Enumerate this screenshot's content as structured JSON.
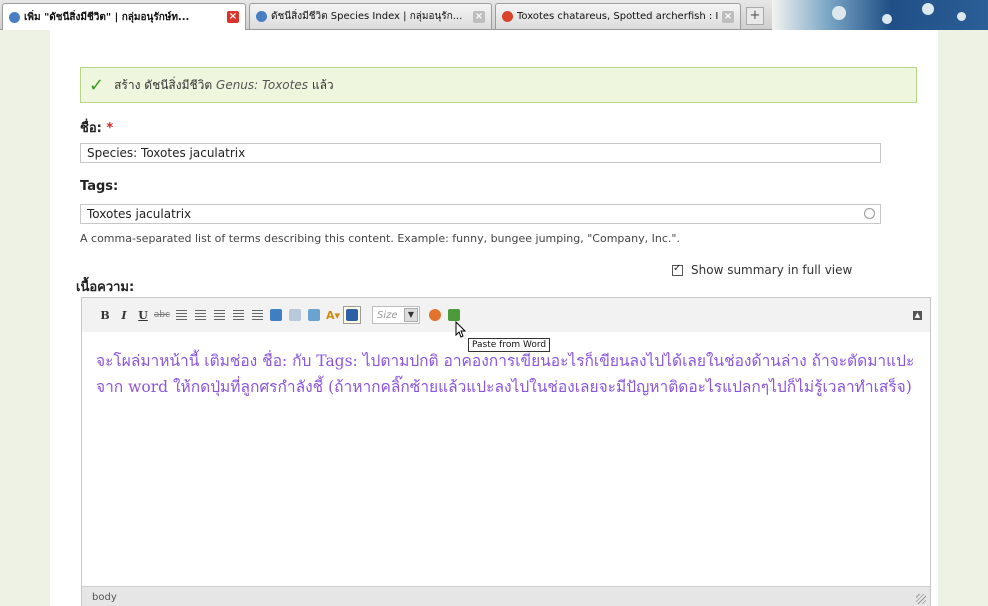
{
  "browser": {
    "tabs": [
      {
        "label": "เพิ่ม \"ดัชนีสิ่งมีชีวิต\" | กลุ่มอนุรักษ์ท...",
        "active": true,
        "favicon_color": "#4a7ec4"
      },
      {
        "label": "ดัชนีสิ่งมีชีวิต Species Index | กลุ่มอนุรัก...",
        "active": false,
        "favicon_color": "#4a7ec4"
      },
      {
        "label": "Toxotes chatareus, Spotted archerfish : I...",
        "active": false,
        "favicon_color": "#d9452b"
      }
    ],
    "new_tab_label": "+"
  },
  "status_message": {
    "prefix": "สร้าง ดัชนีสิ่งมีชีวิต",
    "genus": "Genus: Toxotes",
    "suffix": "แล้ว"
  },
  "form": {
    "title_label": "ชื่อ:",
    "required_mark": "*",
    "title_value": "Species: Toxotes jaculatrix",
    "tags_label": "Tags:",
    "tags_value": "Toxotes jaculatrix",
    "tags_description": "A comma-separated list of terms describing this content. Example: funny, bungee jumping, \"Company, Inc.\".",
    "body_label": "เนื้อความ:",
    "summary_label": "Show summary in full view",
    "summary_checked": true
  },
  "editor": {
    "toolbar": {
      "bold": "B",
      "italic": "I",
      "underline": "U",
      "strike": "abc",
      "size_placeholder": "Size",
      "tooltip": "Paste from Word"
    },
    "content": "จะโผล่มาหน้านี้ เติมช่อง ชื่อ: กับ Tags: ไปตามปกติ อาคองการเขียนอะไรก็เขียนลงไปได้เลยในช่องด้านล่าง ถ้าจะตัดมาแปะจาก word ให้กดปุ่มที่ลูกศรกำลังชี้ (ถ้าหากคลิ๊กซ้ายแล้วแปะลงไปในช่องเลยจะมีปัญหาติดอะไรแปลกๆไปก็ไม่รู้เวลาทำเสร็จ)",
    "status_path": "body"
  },
  "colors": {
    "success_check": "#3c9b22",
    "content_text": "#8a55e0",
    "required": "#d02525"
  }
}
